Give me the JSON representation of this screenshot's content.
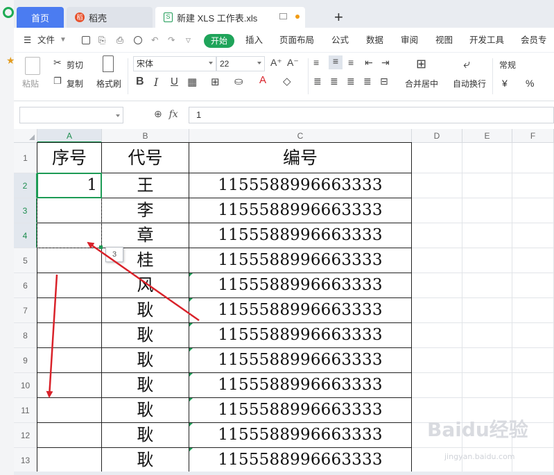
{
  "tabs": {
    "home": "首页",
    "daoke": "稻壳",
    "file": "新建 XLS 工作表.xls",
    "add": "+"
  },
  "menu": {
    "file": "文件",
    "start": "开始",
    "insert": "插入",
    "layout": "页面布局",
    "formula": "公式",
    "data": "数据",
    "review": "审阅",
    "view": "视图",
    "dev": "开发工具",
    "member": "会员专享"
  },
  "ribbon": {
    "paste": "粘贴",
    "cut": "剪切",
    "copy": "复制",
    "format_painter": "格式刷",
    "font_name": "宋体",
    "font_size": "22",
    "merge": "合并居中",
    "wrap": "自动换行",
    "number_format": "常规",
    "currency": "¥",
    "percent": "%"
  },
  "formula_bar": {
    "fx": "fx",
    "value": "1"
  },
  "columns": [
    "A",
    "B",
    "C",
    "D",
    "E",
    "F"
  ],
  "rows": [
    "1",
    "2",
    "3",
    "4",
    "5",
    "6",
    "7",
    "8",
    "9",
    "10",
    "11",
    "12",
    "13"
  ],
  "headers": {
    "a": "序号",
    "b": "代号",
    "c": "编号"
  },
  "a_values": [
    "1",
    "",
    "",
    "",
    "",
    "",
    "",
    "",
    "",
    "",
    "",
    ""
  ],
  "b_values": [
    "王",
    "李",
    "章",
    "桂",
    "风",
    "耿",
    "耿",
    "耿",
    "耿",
    "耿",
    "耿",
    "耿"
  ],
  "c_values": [
    "1155588996663333",
    "1155588996663333",
    "1155588996663333",
    "1155588996663333",
    "1155588996663333",
    "1155588996663333",
    "1155588996663333",
    "1155588996663333",
    "1155588996663333",
    "1155588996663333",
    "1155588996663333",
    "1155588996663333"
  ],
  "fill_tooltip": "3",
  "watermark": "Baidu经验",
  "watermark_sub": "jingyan.baidu.com",
  "colors": {
    "accent_green": "#1d9b55",
    "tab_blue": "#4b7cf1",
    "arrow_red": "#d9222a"
  }
}
